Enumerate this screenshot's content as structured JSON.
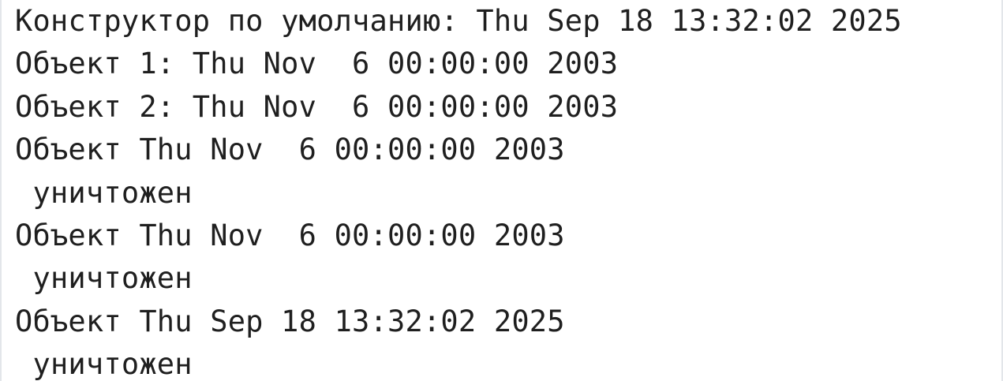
{
  "console": {
    "lines": [
      "Конструктор по умолчанию: Thu Sep 18 13:32:02 2025",
      "Объект 1: Thu Nov  6 00:00:00 2003",
      "Объект 2: Thu Nov  6 00:00:00 2003",
      "Объект Thu Nov  6 00:00:00 2003",
      " уничтожен",
      "Объект Thu Nov  6 00:00:00 2003",
      " уничтожен",
      "Объект Thu Sep 18 13:32:02 2025",
      " уничтожен"
    ]
  }
}
